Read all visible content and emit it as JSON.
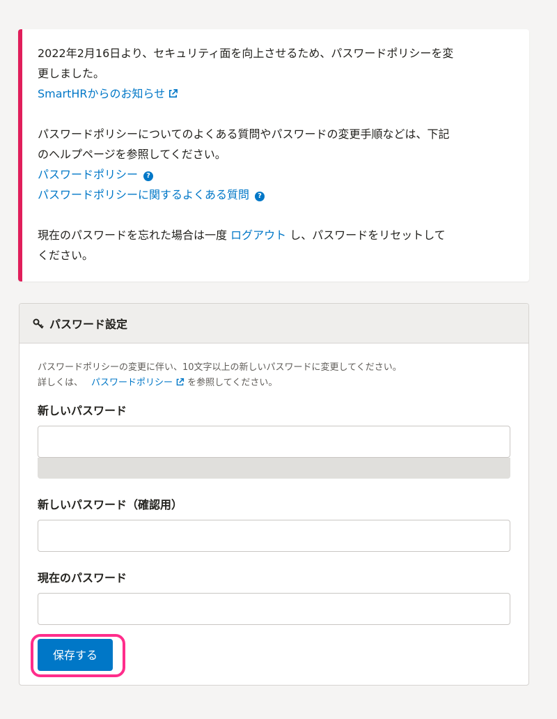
{
  "notice": {
    "line1": "2022年2月16日より、セキュリティ面を向上させるため、パスワードポリシーを変",
    "line2": "更しました。",
    "news_link": "SmartHRからのお知らせ",
    "line3": "パスワードポリシーについてのよくある質問やパスワードの変更手順などは、下記",
    "line4": "のヘルプページを参照してください。",
    "policy_link": "パスワードポリシー",
    "faq_link": "パスワードポリシーに関するよくある質問",
    "line5_pre": "現在のパスワードを忘れた場合は一度",
    "logout_link": "ログアウト",
    "line5_post": "し、パスワードをリセットして",
    "line6": "ください。"
  },
  "panel": {
    "title": "パスワード設定",
    "desc_line1": "パスワードポリシーの変更に伴い、10文字以上の新しいパスワードに変更してください。",
    "desc_pre": "詳しくは、",
    "desc_link": "パスワードポリシー",
    "desc_post": "を参照してください。",
    "new_password_label": "新しいパスワード",
    "new_password_value": "",
    "confirm_password_label": "新しいパスワード（確認用）",
    "confirm_password_value": "",
    "current_password_label": "現在のパスワード",
    "current_password_value": "",
    "save_label": "保存する"
  },
  "colors": {
    "accent": "#e01e5a",
    "link": "#0077c7",
    "button": "#0077c7",
    "highlight": "#ff2d8b"
  }
}
